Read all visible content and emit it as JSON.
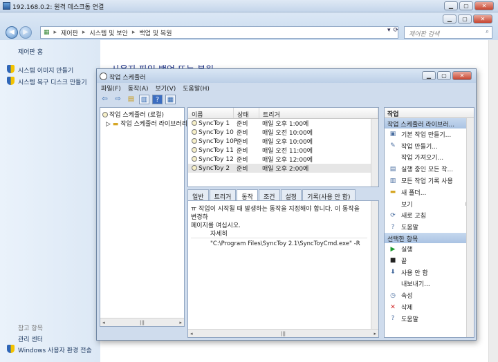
{
  "rdp": {
    "title": "192.168.0.2: 원격 데스크톱 연결"
  },
  "explorer": {
    "breadcrumb": [
      "제어판",
      "시스템 및 보안",
      "백업 및 복원"
    ],
    "search_placeholder": "제어판 검색",
    "left_home": "제어판 홈",
    "left_links": [
      "시스템 이미지 만들기",
      "시스템 복구 디스크 만들기"
    ],
    "see_also_title": "참고 항목",
    "see_also": [
      "관리 센터",
      "Windows 사용자 환경 전송"
    ],
    "main_title": "사용자 파일 백업 또는 복원"
  },
  "ts": {
    "title": "작업 스케줄러",
    "menu": [
      "파일(F)",
      "동작(A)",
      "보기(V)",
      "도움말(H)"
    ],
    "tree": [
      "작업 스케줄러 (로컬)",
      "작업 스케줄러 라이브러리"
    ],
    "columns": [
      "이름",
      "상태",
      "트리거"
    ],
    "tasks": [
      {
        "name": "SyncToy 1",
        "status": "준비",
        "trigger": "매일 오후 1:00에"
      },
      {
        "name": "SyncToy 10",
        "status": "준비",
        "trigger": "매일 오전 10:00에"
      },
      {
        "name": "SyncToy 10P",
        "status": "준비",
        "trigger": "매일 오후 10:00에"
      },
      {
        "name": "SyncToy 11",
        "status": "준비",
        "trigger": "매일 오전 11:00에"
      },
      {
        "name": "SyncToy 12",
        "status": "준비",
        "trigger": "매일 오후 12:00에"
      },
      {
        "name": "SyncToy 2",
        "status": "준비",
        "trigger": "매일 오후 2:00에"
      }
    ],
    "tabs": [
      "일반",
      "트리거",
      "동작",
      "조건",
      "설정",
      "기록(사용 안 함)"
    ],
    "action_desc": "ㅠ 작업이 시작될 때 발생하는 동작을 지정해야 합니다. 이 동작을 변경하\n페이지를 여십시오.",
    "detail_header": "자세히",
    "detail_value": "\"C:\\Program Files\\SyncToy 2.1\\SyncToyCmd.exe\" -R",
    "actions_title": "작업",
    "group1": "작업 스케줄러 라이브러...",
    "group1_items": [
      {
        "label": "기본 작업 만들기...",
        "icon": "basic-task-icon"
      },
      {
        "label": "작업 만들기...",
        "icon": "create-task-icon"
      },
      {
        "label": "작업 가져오기...",
        "icon": ""
      },
      {
        "label": "실행 중인 모든 작...",
        "icon": "running-tasks-icon"
      },
      {
        "label": "모든 작업 기록 사용",
        "icon": "history-icon"
      },
      {
        "label": "새 폴더...",
        "icon": "folder-icon"
      },
      {
        "label": "보기",
        "icon": ""
      },
      {
        "label": "새로 고침",
        "icon": "refresh-icon"
      },
      {
        "label": "도움말",
        "icon": "help-icon"
      }
    ],
    "group2": "선택한 항목",
    "group2_items": [
      {
        "label": "실행",
        "icon": "run-icon"
      },
      {
        "label": "끝",
        "icon": "end-icon"
      },
      {
        "label": "사용 안 함",
        "icon": "disable-icon"
      },
      {
        "label": "내보내기...",
        "icon": ""
      },
      {
        "label": "속성",
        "icon": "properties-icon"
      },
      {
        "label": "삭제",
        "icon": "delete-icon"
      },
      {
        "label": "도움말",
        "icon": "help-icon"
      }
    ]
  }
}
